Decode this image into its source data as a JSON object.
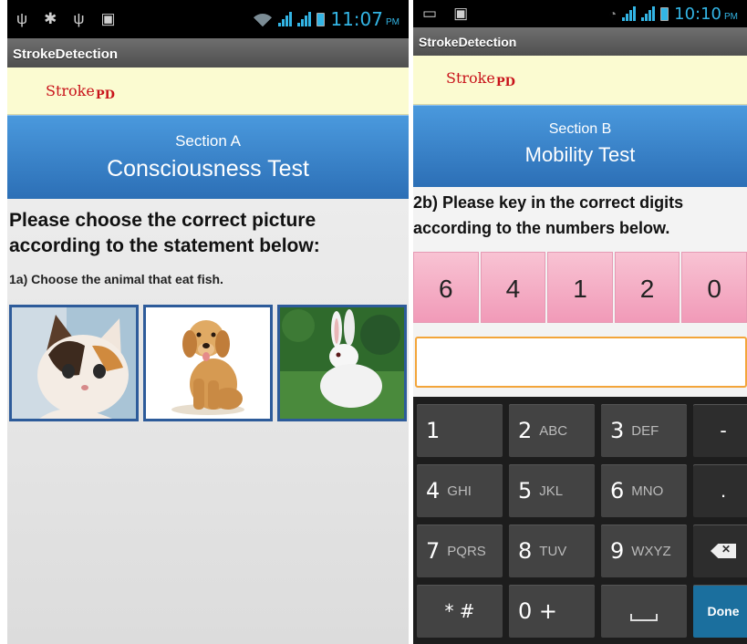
{
  "screen_a": {
    "status": {
      "time": "11:07",
      "ampm": "PM"
    },
    "app_title": "StrokeDetection",
    "brand": {
      "main": "Stroke",
      "sub": "PD"
    },
    "section": {
      "label": "Section A",
      "title": "Consciousness Test"
    },
    "question": "Please choose the correct picture according to the statement below:",
    "sub_question": "1a) Choose the animal that eat fish.",
    "pictures": [
      "cat-picture",
      "dog-picture",
      "rabbit-picture"
    ]
  },
  "screen_b": {
    "status": {
      "time": "10:10",
      "ampm": "PM"
    },
    "app_title": "StrokeDetection",
    "brand": {
      "main": "Stroke",
      "sub": "PD"
    },
    "section": {
      "label": "Section B",
      "title": "Mobility Test"
    },
    "question": "2b) Please key in the correct digits according to the numbers below.",
    "digits": [
      "6",
      "4",
      "1",
      "2",
      "0"
    ],
    "answer_value": "",
    "keypad": {
      "k1": {
        "num": "1",
        "alpha": ""
      },
      "k2": {
        "num": "2",
        "alpha": "ABC"
      },
      "k3": {
        "num": "3",
        "alpha": "DEF"
      },
      "minus": "-",
      "k4": {
        "num": "4",
        "alpha": "GHI"
      },
      "k5": {
        "num": "5",
        "alpha": "JKL"
      },
      "k6": {
        "num": "6",
        "alpha": "MNO"
      },
      "dot": ".",
      "k7": {
        "num": "7",
        "alpha": "PQRS"
      },
      "k8": {
        "num": "8",
        "alpha": "TUV"
      },
      "k9": {
        "num": "9",
        "alpha": "WXYZ"
      },
      "star": "* #",
      "k0": {
        "num": "0 +",
        "alpha": ""
      },
      "done": "Done"
    }
  }
}
